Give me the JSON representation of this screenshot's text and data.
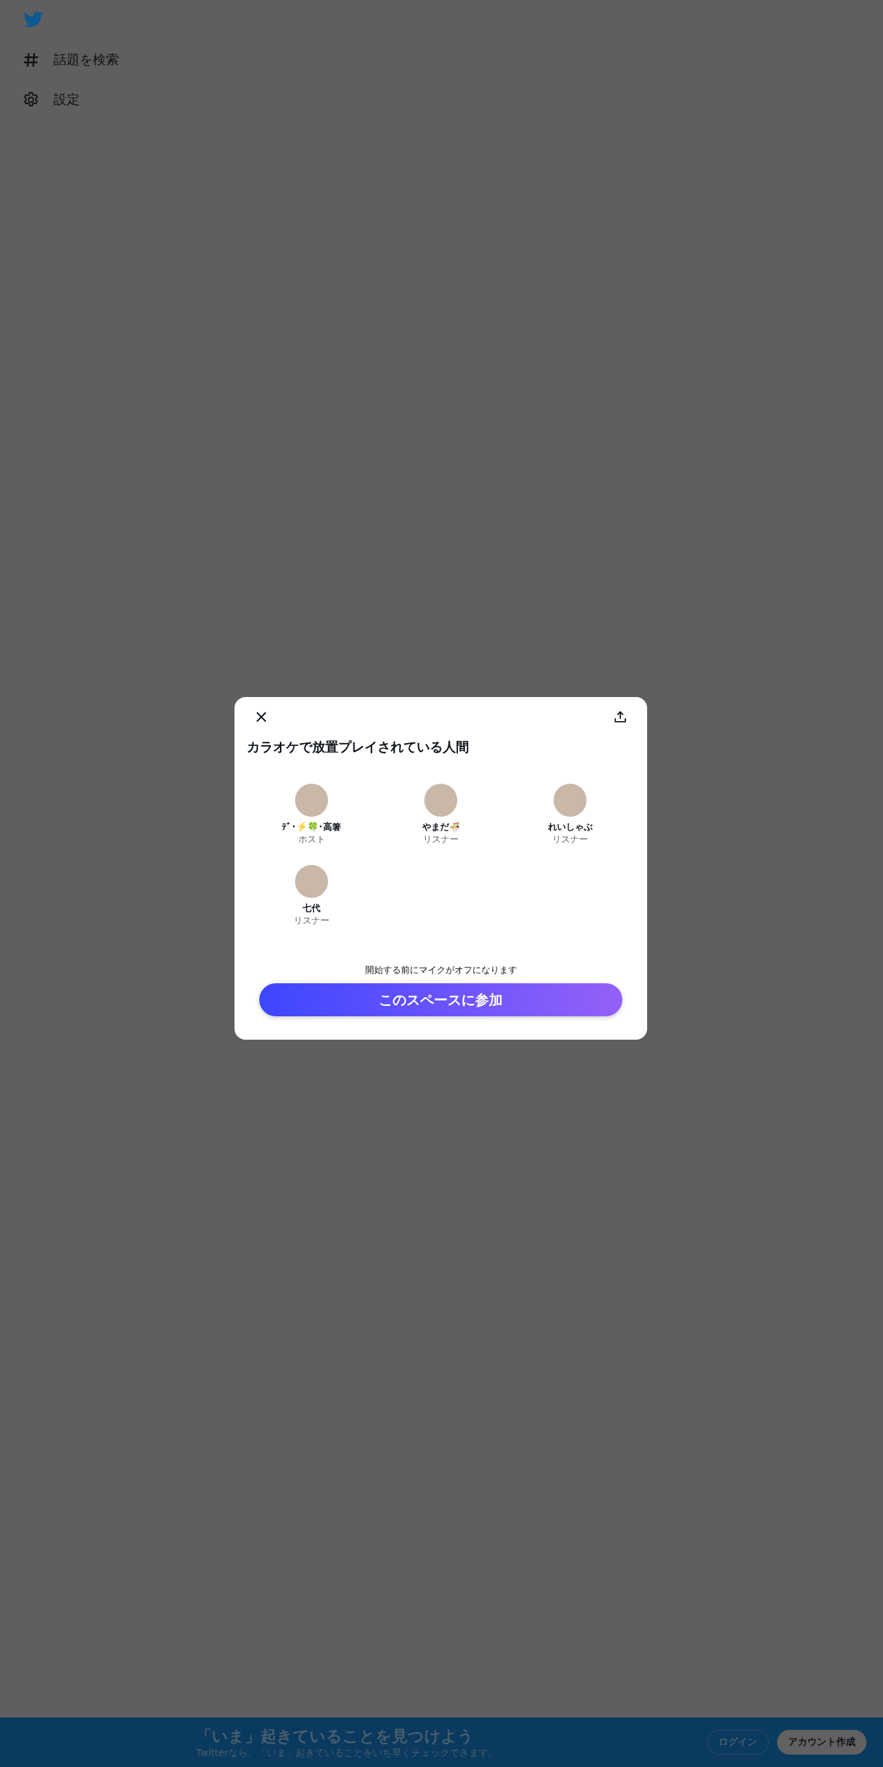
{
  "sidebar": {
    "items": [
      {
        "kind": "hashtag",
        "label": "話題を検索"
      },
      {
        "kind": "settings",
        "label": "設定"
      }
    ]
  },
  "space_dialog": {
    "title": "カラオケで放置プレイされている人間",
    "participants": [
      {
        "name": "ﾃﾞ･⚡️🍀･高箸",
        "role": "ホスト"
      },
      {
        "name": "やまだ🍜",
        "role": "リスナー"
      },
      {
        "name": "れいしゃぶ",
        "role": "リスナー"
      },
      {
        "name": "七代",
        "role": "リスナー"
      }
    ],
    "notice": "開始する前にマイクがオフになります",
    "join_button": "このスペースに参加"
  },
  "bottom_bar": {
    "heading": "「いま」起きていることを見つけよう",
    "subtitle": "Twitterなら、「いま」起きていることをいち早くチェックできます。",
    "login_button": "ログイン",
    "signup_button": "アカウント作成"
  }
}
